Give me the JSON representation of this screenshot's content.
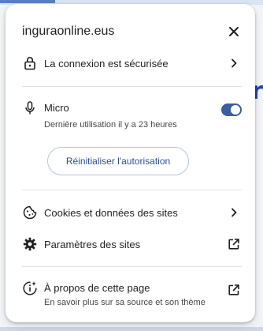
{
  "site": {
    "domain": "inguraonline.eus"
  },
  "background": {
    "partial_text": "r"
  },
  "connection": {
    "label": "La connexion est sécurisée"
  },
  "microphone": {
    "label": "Micro",
    "last_used": "Dernière utilisation il y a 23 heures",
    "enabled": true,
    "reset_label": "Réinitialiser l'autorisation"
  },
  "cookies": {
    "label": "Cookies et données des sites"
  },
  "site_settings": {
    "label": "Paramètres des sites"
  },
  "about": {
    "label": "À propos de cette page",
    "description": "En savoir plus sur sa source et son thème"
  },
  "colors": {
    "accent": "#3b5f9e",
    "button_text": "#2c4f8f"
  },
  "icons": [
    "lock-icon",
    "microphone-icon",
    "cookie-icon",
    "gear-icon",
    "info-sparkle-icon",
    "close-icon",
    "chevron-right-icon",
    "open-external-icon"
  ]
}
